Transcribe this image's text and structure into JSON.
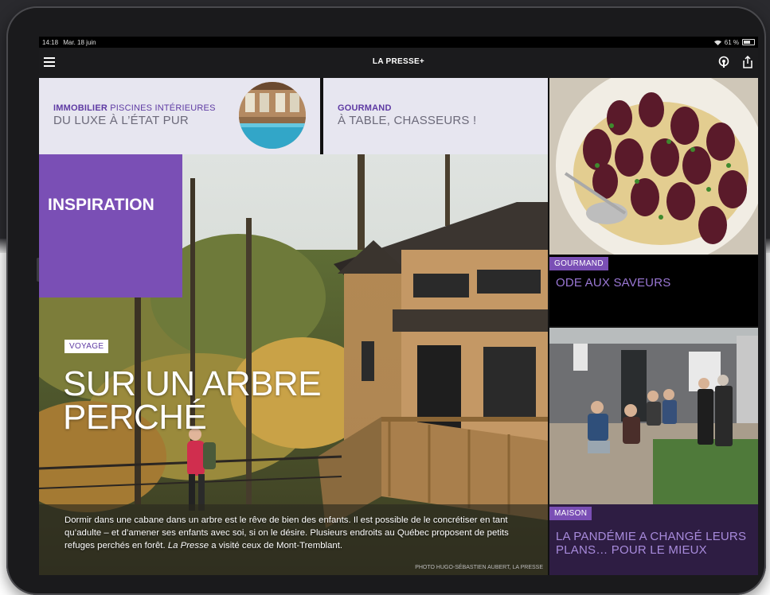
{
  "status_bar": {
    "time": "14:18",
    "date": "Mar. 18 juin",
    "battery": "61 %"
  },
  "app": {
    "logo": "LA PRESSE+"
  },
  "tiles": {
    "immobilier": {
      "kicker": "IMMOBILIER",
      "kicker_sub": "PISCINES INTÉRIEURES",
      "headline": "DU LUXE À L’ÉTAT PUR"
    },
    "gourmand_top": {
      "kicker": "GOURMAND",
      "headline": "À TABLE, CHASSEURS !"
    }
  },
  "hero": {
    "section": "INSPIRATION",
    "badge": "VOYAGE",
    "title": "SUR UN ARBRE PERCHÉ",
    "desc_part1": "Dormir dans une cabane dans un arbre est le rêve de bien des enfants. Il est possible de le concrétiser en tant qu’adulte – et d’amener ses enfants avec soi, si on le désire. Plusieurs endroits au Québec proposent de petits refuges perchés en forêt. ",
    "desc_italic": "La Presse",
    "desc_part2": " a visité ceux de Mont-Tremblant.",
    "credit": "PHOTO HUGO-SÉBASTIEN AUBERT, LA PRESSE"
  },
  "right": {
    "food": {
      "badge": "GOURMAND",
      "headline": "ODE AUX SAVEURS"
    },
    "house": {
      "badge": "MAISON",
      "headline": "LA PANDÉMIE A CHANGÉ LEURS PLANS… POUR LE MIEUX"
    }
  },
  "colors": {
    "accent_purple": "#7a4fb5",
    "kicker_purple": "#5e3aa3",
    "tile_bg": "#e7e6f0"
  },
  "icons": [
    "menu-icon",
    "podcast-icon",
    "share-icon",
    "wifi-icon",
    "battery-icon"
  ]
}
